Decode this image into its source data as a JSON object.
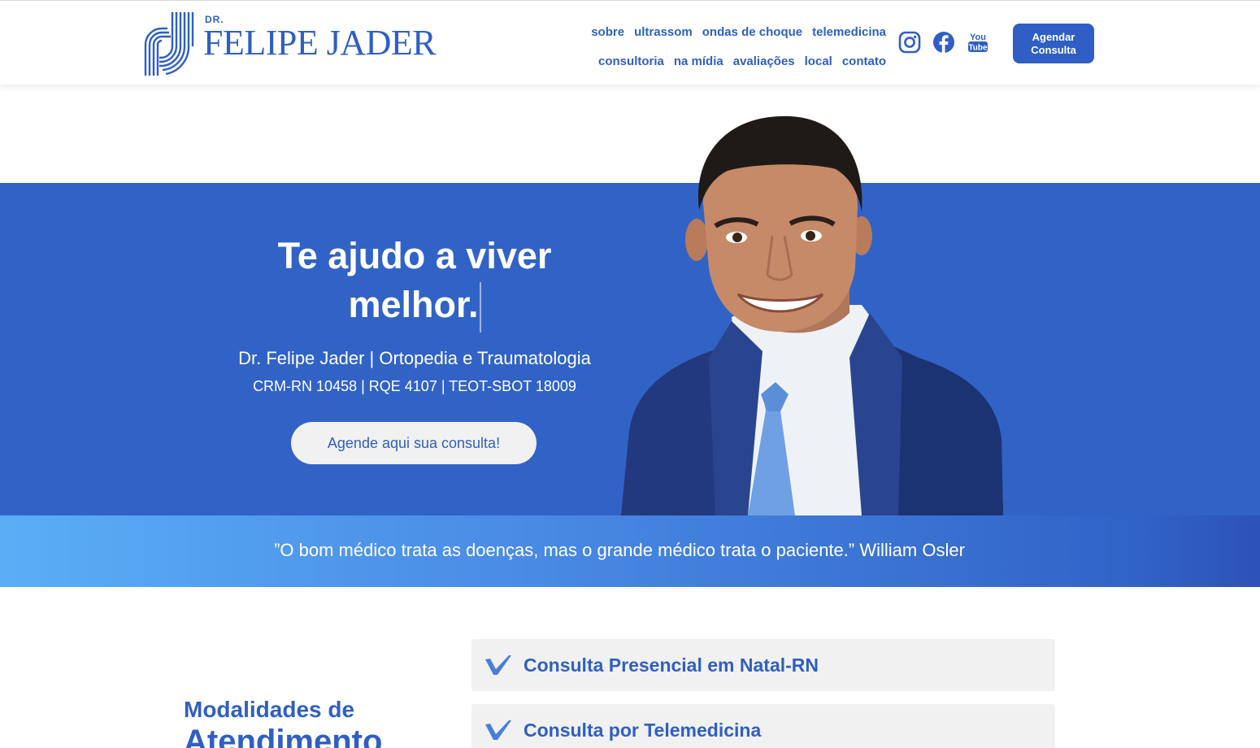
{
  "brand": {
    "prefix": "DR.",
    "name": "FELIPE JADER",
    "accent": "#2f5fc4"
  },
  "nav": {
    "row1": [
      "sobre",
      "ultrassom",
      "ondas de choque",
      "telemedicina"
    ],
    "row2": [
      "consultoria",
      "na mídia",
      "avaliações",
      "local",
      "contato"
    ]
  },
  "socials": {
    "instagram": "instagram-icon",
    "facebook": "facebook-icon",
    "youtube_top": "You",
    "youtube_bottom": "Tube"
  },
  "header_cta": {
    "line1": "Agendar",
    "line2": "Consulta"
  },
  "hero": {
    "title_line1": "Te ajudo a viver",
    "title_line2": "melhor.",
    "subtitle": "Dr. Felipe Jader | Ortopedia e Traumatologia",
    "credentials": "CRM-RN 10458 | RQE 4107 | TEOT-SBOT 18009",
    "button": "Agende aqui sua consulta!",
    "background": "#3163c7"
  },
  "quote": {
    "text": "”O bom médico trata as doenças, mas o grande médico trata o paciente.” William Osler"
  },
  "modalities": {
    "title_line1": "Modalidades de",
    "title_line2": "Atendimento",
    "items": [
      "Consulta Presencial em Natal-RN",
      "Consulta por Telemedicina"
    ]
  }
}
